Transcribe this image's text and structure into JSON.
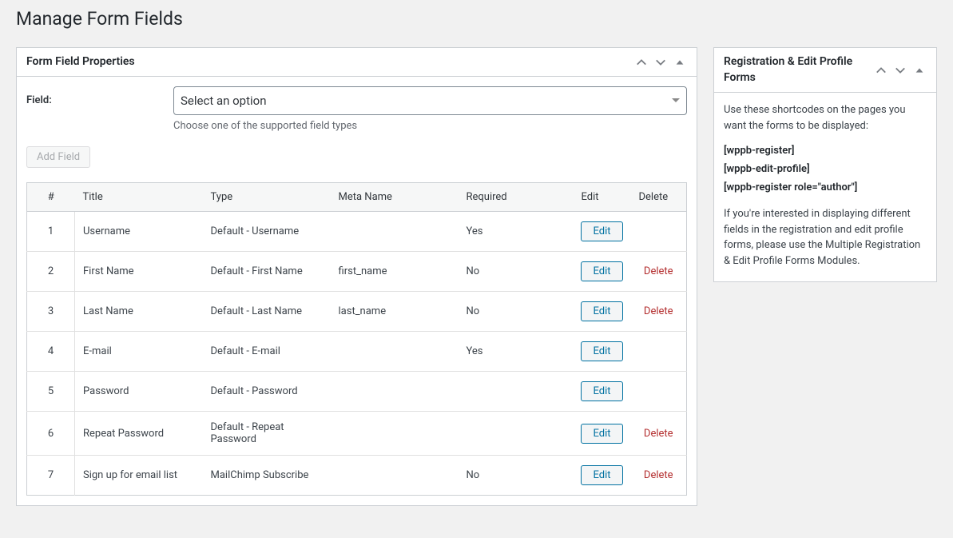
{
  "page_title": "Manage Form Fields",
  "main_box": {
    "title": "Form Field Properties",
    "field_label": "Field:",
    "select_placeholder": "Select an option",
    "help_text": "Choose one of the supported field types",
    "add_button": "Add Field",
    "table": {
      "headers": {
        "num": "#",
        "title": "Title",
        "type": "Type",
        "meta": "Meta Name",
        "required": "Required",
        "edit": "Edit",
        "delete": "Delete"
      },
      "edit_label": "Edit",
      "delete_label": "Delete",
      "rows": [
        {
          "num": "1",
          "title": "Username",
          "type": "Default - Username",
          "meta": "",
          "required": "Yes",
          "deletable": false
        },
        {
          "num": "2",
          "title": "First Name",
          "type": "Default - First Name",
          "meta": "first_name",
          "required": "No",
          "deletable": true
        },
        {
          "num": "3",
          "title": "Last Name",
          "type": "Default - Last Name",
          "meta": "last_name",
          "required": "No",
          "deletable": true
        },
        {
          "num": "4",
          "title": "E-mail",
          "type": "Default - E-mail",
          "meta": "",
          "required": "Yes",
          "deletable": false
        },
        {
          "num": "5",
          "title": "Password",
          "type": "Default - Password",
          "meta": "",
          "required": "",
          "deletable": false
        },
        {
          "num": "6",
          "title": "Repeat Password",
          "type": "Default - Repeat Password",
          "meta": "",
          "required": "",
          "deletable": true
        },
        {
          "num": "7",
          "title": "Sign up for email list",
          "type": "MailChimp Subscribe",
          "meta": "",
          "required": "No",
          "deletable": true
        }
      ]
    }
  },
  "side_box": {
    "title": "Registration & Edit Profile Forms",
    "intro": "Use these shortcodes on the pages you want the forms to be displayed:",
    "shortcodes": [
      "[wppb-register]",
      "[wppb-edit-profile]",
      "[wppb-register role=\"author\"]"
    ],
    "outro": "If you're interested in displaying different fields in the registration and edit profile forms, please use the Multiple Registration & Edit Profile Forms Modules."
  }
}
